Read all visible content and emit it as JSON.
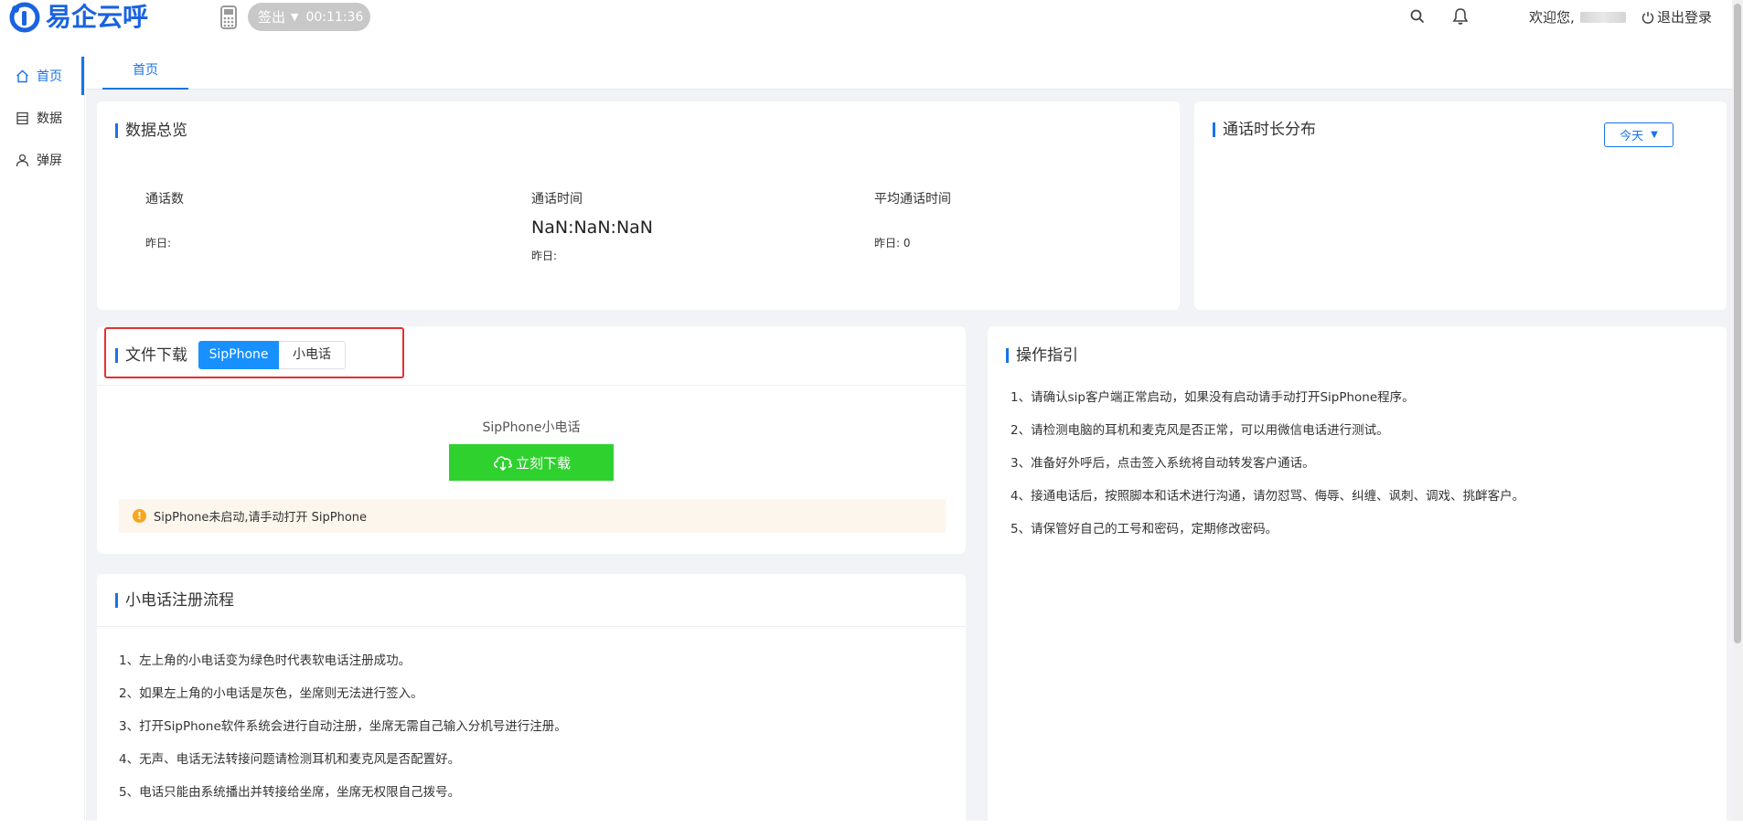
{
  "app": {
    "brand": "易企云呼",
    "signout_label": "签出",
    "timer": "00:11:36"
  },
  "topbar": {
    "welcome": "欢迎您,",
    "logout": "退出登录"
  },
  "sidebar": {
    "items": [
      {
        "label": "首页",
        "icon": "home-icon"
      },
      {
        "label": "数据",
        "icon": "list-icon"
      },
      {
        "label": "弹屏",
        "icon": "user-icon"
      }
    ]
  },
  "tabs": [
    {
      "label": "首页"
    }
  ],
  "overview": {
    "title": "数据总览",
    "stats": [
      {
        "label": "通话数",
        "value": "",
        "sub": "昨日:"
      },
      {
        "label": "通话时间",
        "value": "NaN:NaN:NaN",
        "sub": "昨日:"
      },
      {
        "label": "平均通话时间",
        "value": "",
        "sub": "昨日: 0"
      }
    ]
  },
  "duration": {
    "title": "通话时长分布",
    "range_selected": "今天"
  },
  "download": {
    "title": "文件下载",
    "tabs": [
      "SipPhone",
      "小电话"
    ],
    "active_tab": "SipPhone",
    "caption": "SipPhone小电话",
    "button": "立刻下载",
    "warning": "SipPhone未启动,请手动打开 SipPhone"
  },
  "register": {
    "title": "小电话注册流程",
    "steps": [
      "1、左上角的小电话变为绿色时代表软电话注册成功。",
      "2、如果左上角的小电话是灰色，坐席则无法进行签入。",
      "3、打开SipPhone软件系统会进行自动注册，坐席无需自己输入分机号进行注册。",
      "4、无声、电话无法转接问题请检测耳机和麦克风是否配置好。",
      "5、电话只能由系统播出并转接给坐席，坐席无权限自己拨号。"
    ]
  },
  "guide": {
    "title": "操作指引",
    "steps": [
      "1、请确认sip客户端正常启动，如果没有启动请手动打开SipPhone程序。",
      "2、请检测电脑的耳机和麦克风是否正常，可以用微信电话进行测试。",
      "3、准备好外呼后，点击签入系统将自动转发客户通话。",
      "4、接通电话后，按照脚本和话术进行沟通，请勿怼骂、侮辱、纠缠、讽刺、调戏、挑衅客户。",
      "5、请保管好自己的工号和密码，定期修改密码。"
    ]
  },
  "colors": {
    "accent": "#1a73e8",
    "download_green": "#2fd12f",
    "highlight_red": "#e53030",
    "warning_orange": "#f5a623"
  }
}
